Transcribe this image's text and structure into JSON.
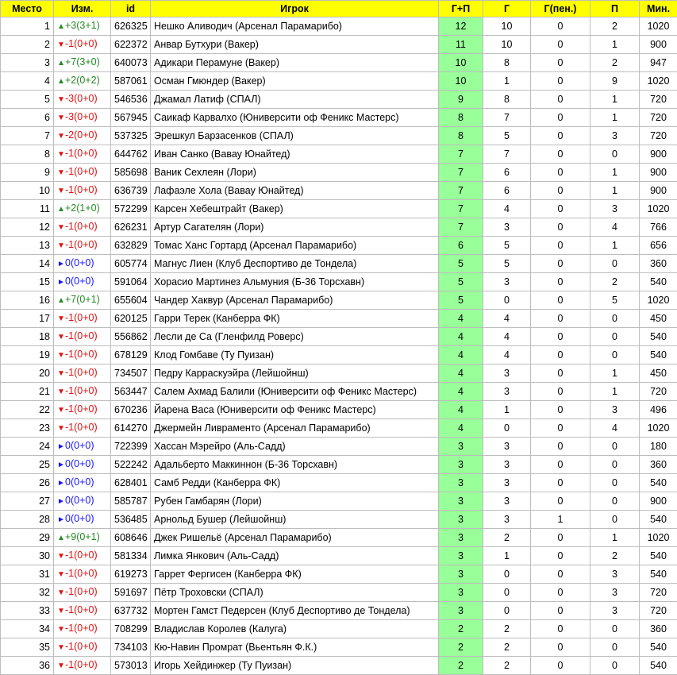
{
  "colors": {
    "header_bg": "#ffff00",
    "gp_bg": "#99ff99",
    "up": "#228b22",
    "down": "#e01010",
    "same": "#1515ff"
  },
  "headers": [
    "Место",
    "Изм.",
    "id",
    "Игрок",
    "Г+П",
    "Г",
    "Г(пен.)",
    "П",
    "Мин."
  ],
  "rows": [
    {
      "place": "1",
      "dir": "up",
      "arrow": "▲",
      "change": "+3(3+1)",
      "id": "626325",
      "player": "Нешко Аливодич (Арсенал Парамарибо)",
      "gp": "12",
      "g": "10",
      "gpen": "0",
      "p": "2",
      "min": "1020"
    },
    {
      "place": "2",
      "dir": "down",
      "arrow": "▼",
      "change": "-1(0+0)",
      "id": "622372",
      "player": "Анвар Бутхури (Вакер)",
      "gp": "11",
      "g": "10",
      "gpen": "0",
      "p": "1",
      "min": "900"
    },
    {
      "place": "3",
      "dir": "up",
      "arrow": "▲",
      "change": "+7(3+0)",
      "id": "640073",
      "player": "Адикари Перамуне (Вакер)",
      "gp": "10",
      "g": "8",
      "gpen": "0",
      "p": "2",
      "min": "947"
    },
    {
      "place": "4",
      "dir": "up",
      "arrow": "▲",
      "change": "+2(0+2)",
      "id": "587061",
      "player": "Осман Гмюндер (Вакер)",
      "gp": "10",
      "g": "1",
      "gpen": "0",
      "p": "9",
      "min": "1020"
    },
    {
      "place": "5",
      "dir": "down",
      "arrow": "▼",
      "change": "-3(0+0)",
      "id": "546536",
      "player": "Джамал Латиф (СПАЛ)",
      "gp": "9",
      "g": "8",
      "gpen": "0",
      "p": "1",
      "min": "720"
    },
    {
      "place": "6",
      "dir": "down",
      "arrow": "▼",
      "change": "-3(0+0)",
      "id": "567945",
      "player": "Саикаф Карвалхо (Юниверсити оф Феникс Мастерс)",
      "gp": "8",
      "g": "7",
      "gpen": "0",
      "p": "1",
      "min": "720"
    },
    {
      "place": "7",
      "dir": "down",
      "arrow": "▼",
      "change": "-2(0+0)",
      "id": "537325",
      "player": "Эрешкул Барзасенков (СПАЛ)",
      "gp": "8",
      "g": "5",
      "gpen": "0",
      "p": "3",
      "min": "720"
    },
    {
      "place": "8",
      "dir": "down",
      "arrow": "▼",
      "change": "-1(0+0)",
      "id": "644762",
      "player": "Иван Санко (Вавау Юнайтед)",
      "gp": "7",
      "g": "7",
      "gpen": "0",
      "p": "0",
      "min": "900"
    },
    {
      "place": "9",
      "dir": "down",
      "arrow": "▼",
      "change": "-1(0+0)",
      "id": "585698",
      "player": "Ваник Сехлеян (Лори)",
      "gp": "7",
      "g": "6",
      "gpen": "0",
      "p": "1",
      "min": "900"
    },
    {
      "place": "10",
      "dir": "down",
      "arrow": "▼",
      "change": "-1(0+0)",
      "id": "636739",
      "player": "Лафаэле Хола (Вавау Юнайтед)",
      "gp": "7",
      "g": "6",
      "gpen": "0",
      "p": "1",
      "min": "900"
    },
    {
      "place": "11",
      "dir": "up",
      "arrow": "▲",
      "change": "+2(1+0)",
      "id": "572299",
      "player": "Карсен Хебештрайт (Вакер)",
      "gp": "7",
      "g": "4",
      "gpen": "0",
      "p": "3",
      "min": "1020"
    },
    {
      "place": "12",
      "dir": "down",
      "arrow": "▼",
      "change": "-1(0+0)",
      "id": "626231",
      "player": "Артур Сагателян (Лори)",
      "gp": "7",
      "g": "3",
      "gpen": "0",
      "p": "4",
      "min": "766"
    },
    {
      "place": "13",
      "dir": "down",
      "arrow": "▼",
      "change": "-1(0+0)",
      "id": "632829",
      "player": "Томас Ханс Гортард (Арсенал Парамарибо)",
      "gp": "6",
      "g": "5",
      "gpen": "0",
      "p": "1",
      "min": "656"
    },
    {
      "place": "14",
      "dir": "same",
      "arrow": "►",
      "change": "0(0+0)",
      "id": "605774",
      "player": "Магнус Лиен (Клуб Деспортиво де Тондела)",
      "gp": "5",
      "g": "5",
      "gpen": "0",
      "p": "0",
      "min": "360"
    },
    {
      "place": "15",
      "dir": "same",
      "arrow": "►",
      "change": "0(0+0)",
      "id": "591064",
      "player": "Хорасио Мартинез Альмуния (Б-36 Торсхавн)",
      "gp": "5",
      "g": "3",
      "gpen": "0",
      "p": "2",
      "min": "540"
    },
    {
      "place": "16",
      "dir": "up",
      "arrow": "▲",
      "change": "+7(0+1)",
      "id": "655604",
      "player": "Чандер Хаквур (Арсенал Парамарибо)",
      "gp": "5",
      "g": "0",
      "gpen": "0",
      "p": "5",
      "min": "1020"
    },
    {
      "place": "17",
      "dir": "down",
      "arrow": "▼",
      "change": "-1(0+0)",
      "id": "620125",
      "player": "Гарри Терек (Канберра ФК)",
      "gp": "4",
      "g": "4",
      "gpen": "0",
      "p": "0",
      "min": "450"
    },
    {
      "place": "18",
      "dir": "down",
      "arrow": "▼",
      "change": "-1(0+0)",
      "id": "556862",
      "player": "Лесли де Са (Гленфилд Роверс)",
      "gp": "4",
      "g": "4",
      "gpen": "0",
      "p": "0",
      "min": "540"
    },
    {
      "place": "19",
      "dir": "down",
      "arrow": "▼",
      "change": "-1(0+0)",
      "id": "678129",
      "player": "Клод Гомбаве (Ту Пуизан)",
      "gp": "4",
      "g": "4",
      "gpen": "0",
      "p": "0",
      "min": "540"
    },
    {
      "place": "20",
      "dir": "down",
      "arrow": "▼",
      "change": "-1(0+0)",
      "id": "734507",
      "player": "Педру Карраскуэйра (Лейшойнш)",
      "gp": "4",
      "g": "3",
      "gpen": "0",
      "p": "1",
      "min": "450"
    },
    {
      "place": "21",
      "dir": "down",
      "arrow": "▼",
      "change": "-1(0+0)",
      "id": "563447",
      "player": "Салем Ахмад Балили (Юниверсити оф Феникс Мастерс)",
      "gp": "4",
      "g": "3",
      "gpen": "0",
      "p": "1",
      "min": "720"
    },
    {
      "place": "22",
      "dir": "down",
      "arrow": "▼",
      "change": "-1(0+0)",
      "id": "670236",
      "player": "Йарена Васа (Юниверсити оф Феникс Мастерс)",
      "gp": "4",
      "g": "1",
      "gpen": "0",
      "p": "3",
      "min": "496"
    },
    {
      "place": "23",
      "dir": "down",
      "arrow": "▼",
      "change": "-1(0+0)",
      "id": "614270",
      "player": "Джермейн Ливраменто (Арсенал Парамарибо)",
      "gp": "4",
      "g": "0",
      "gpen": "0",
      "p": "4",
      "min": "1020"
    },
    {
      "place": "24",
      "dir": "same",
      "arrow": "►",
      "change": "0(0+0)",
      "id": "722399",
      "player": "Хассан Мэрейро (Аль-Садд)",
      "gp": "3",
      "g": "3",
      "gpen": "0",
      "p": "0",
      "min": "180"
    },
    {
      "place": "25",
      "dir": "same",
      "arrow": "►",
      "change": "0(0+0)",
      "id": "522242",
      "player": "Адальберто Маккиннон (Б-36 Торсхавн)",
      "gp": "3",
      "g": "3",
      "gpen": "0",
      "p": "0",
      "min": "360"
    },
    {
      "place": "26",
      "dir": "same",
      "arrow": "►",
      "change": "0(0+0)",
      "id": "628401",
      "player": "Самб Редди (Канберра ФК)",
      "gp": "3",
      "g": "3",
      "gpen": "0",
      "p": "0",
      "min": "540"
    },
    {
      "place": "27",
      "dir": "same",
      "arrow": "►",
      "change": "0(0+0)",
      "id": "585787",
      "player": "Рубен Гамбарян (Лори)",
      "gp": "3",
      "g": "3",
      "gpen": "0",
      "p": "0",
      "min": "900"
    },
    {
      "place": "28",
      "dir": "same",
      "arrow": "►",
      "change": "0(0+0)",
      "id": "536485",
      "player": "Арнольд Бушер (Лейшойнш)",
      "gp": "3",
      "g": "3",
      "gpen": "1",
      "p": "0",
      "min": "540"
    },
    {
      "place": "29",
      "dir": "up",
      "arrow": "▲",
      "change": "+9(0+1)",
      "id": "608646",
      "player": "Джек Ришельё (Арсенал Парамарибо)",
      "gp": "3",
      "g": "2",
      "gpen": "0",
      "p": "1",
      "min": "1020"
    },
    {
      "place": "30",
      "dir": "down",
      "arrow": "▼",
      "change": "-1(0+0)",
      "id": "581334",
      "player": "Лимка Янкович (Аль-Садд)",
      "gp": "3",
      "g": "1",
      "gpen": "0",
      "p": "2",
      "min": "540"
    },
    {
      "place": "31",
      "dir": "down",
      "arrow": "▼",
      "change": "-1(0+0)",
      "id": "619273",
      "player": "Гаррет Фергисен (Канберра ФК)",
      "gp": "3",
      "g": "0",
      "gpen": "0",
      "p": "3",
      "min": "540"
    },
    {
      "place": "32",
      "dir": "down",
      "arrow": "▼",
      "change": "-1(0+0)",
      "id": "591697",
      "player": "Пётр Троховски (СПАЛ)",
      "gp": "3",
      "g": "0",
      "gpen": "0",
      "p": "3",
      "min": "720"
    },
    {
      "place": "33",
      "dir": "down",
      "arrow": "▼",
      "change": "-1(0+0)",
      "id": "637732",
      "player": "Мортен Гамст Педерсен (Клуб Деспортиво де Тондела)",
      "gp": "3",
      "g": "0",
      "gpen": "0",
      "p": "3",
      "min": "720"
    },
    {
      "place": "34",
      "dir": "down",
      "arrow": "▼",
      "change": "-1(0+0)",
      "id": "708299",
      "player": "Владислав Королев (Калуга)",
      "gp": "2",
      "g": "2",
      "gpen": "0",
      "p": "0",
      "min": "360"
    },
    {
      "place": "35",
      "dir": "down",
      "arrow": "▼",
      "change": "-1(0+0)",
      "id": "734103",
      "player": "Кю-Навин Промрат (Вьентьян Ф.К.)",
      "gp": "2",
      "g": "2",
      "gpen": "0",
      "p": "0",
      "min": "540"
    },
    {
      "place": "36",
      "dir": "down",
      "arrow": "▼",
      "change": "-1(0+0)",
      "id": "573013",
      "player": "Игорь Хейдинжер (Ту Пуизан)",
      "gp": "2",
      "g": "2",
      "gpen": "0",
      "p": "0",
      "min": "540"
    }
  ]
}
